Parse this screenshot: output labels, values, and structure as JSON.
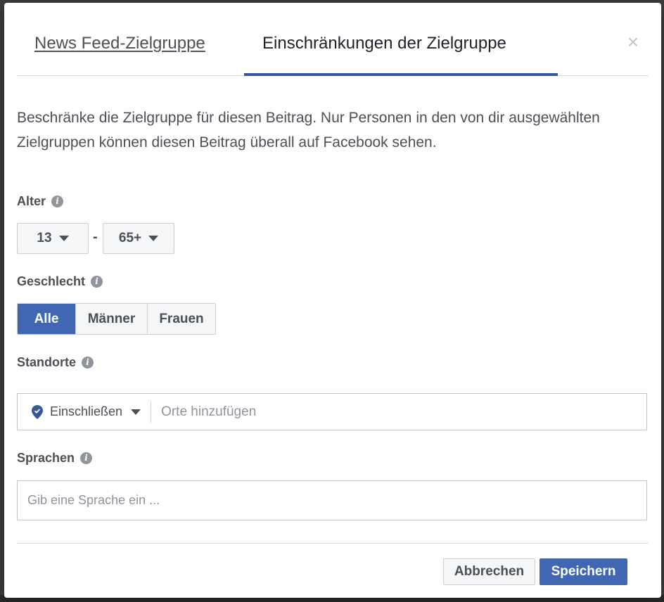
{
  "tabs": [
    {
      "label": "News Feed-Zielgruppe"
    },
    {
      "label": "Einschränkungen der Zielgruppe"
    }
  ],
  "close_label": "×",
  "description": "Beschränke die Zielgruppe für diesen Beitrag. Nur Personen in den von dir ausgewählten Zielgruppen können diesen Beitrag überall auf Facebook sehen.",
  "age": {
    "label": "Alter",
    "from": "13",
    "separator": "-",
    "to": "65+"
  },
  "gender": {
    "label": "Geschlecht",
    "options": [
      "Alle",
      "Männer",
      "Frauen"
    ],
    "selected": "Alle"
  },
  "locations": {
    "label": "Standorte",
    "mode": "Einschließen",
    "placeholder": "Orte hinzufügen"
  },
  "languages": {
    "label": "Sprachen",
    "placeholder": "Gib eine Sprache ein ..."
  },
  "info_icon_glyph": "i",
  "buttons": {
    "cancel": "Abbrechen",
    "save": "Speichern"
  },
  "colors": {
    "accent": "#4267b2",
    "tab_indicator": "#365899",
    "pin": "#365899"
  }
}
